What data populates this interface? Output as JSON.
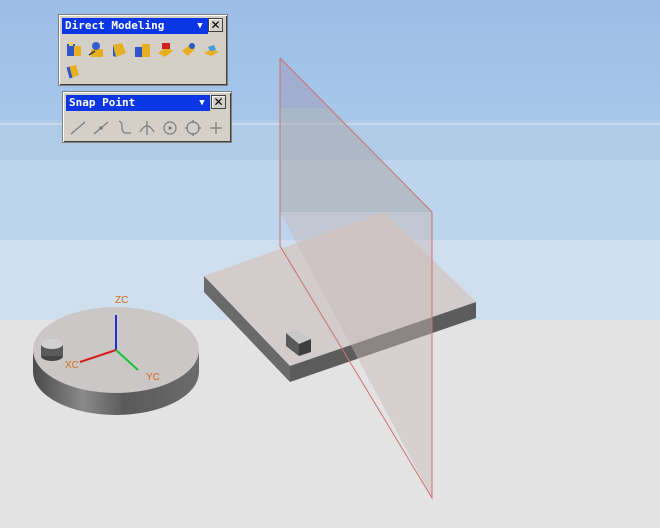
{
  "toolbars": {
    "direct_modeling": {
      "title": "Direct Modeling",
      "tools": [
        "direct-modeling-tool-1-icon",
        "direct-modeling-tool-2-icon",
        "direct-modeling-tool-3-icon",
        "direct-modeling-tool-4-icon",
        "direct-modeling-tool-5-icon",
        "direct-modeling-tool-6-icon",
        "direct-modeling-tool-7-icon",
        "direct-modeling-tool-8-icon"
      ]
    },
    "snap_point": {
      "title": "Snap Point",
      "tools": [
        "end-point-icon",
        "mid-point-icon",
        "control-point-icon",
        "intersection-point-icon",
        "arc-center-icon",
        "quadrant-point-icon",
        "existing-point-icon"
      ]
    }
  },
  "axes": {
    "z": "ZC",
    "x": "XC",
    "y": "YC"
  },
  "colors": {
    "axis_z": "#1f2fd8",
    "axis_x": "#d81f1f",
    "axis_y": "#19c23a",
    "axis_label": "#d96a1a",
    "title_bar": "#0a36e6",
    "plane_edge": "#d07070"
  }
}
